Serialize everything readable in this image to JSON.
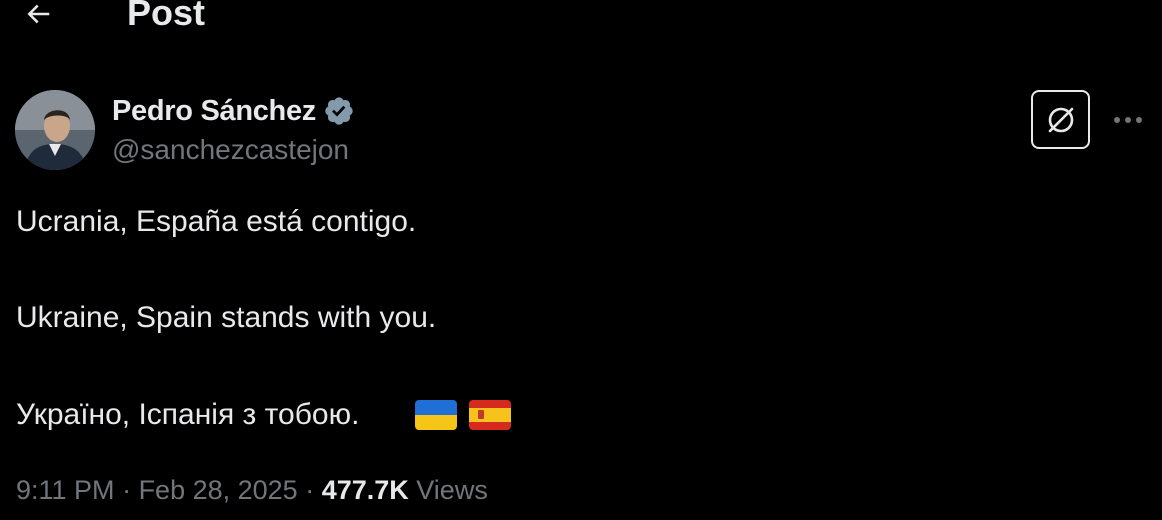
{
  "header": {
    "title": "Post",
    "back_icon": "arrow-left-icon"
  },
  "author": {
    "name": "Pedro Sánchez",
    "handle": "@sanchezcastejon",
    "verified_color": "#829aab"
  },
  "actions": {
    "grok_icon": "grok-icon",
    "more_icon": "more-dots-icon"
  },
  "post": {
    "lines": [
      "Ucrania, España está contigo.",
      "Ukraine, Spain stands with you.",
      "Україно, Іспанія з тобою."
    ],
    "flags": [
      "ukraine-flag",
      "spain-flag"
    ]
  },
  "meta": {
    "time": "9:11 PM",
    "separator": " · ",
    "date": "Feb 28, 2025",
    "views_count": "477.7K",
    "views_label": " Views"
  },
  "colors": {
    "background": "#000000",
    "text_primary": "#e7e9ea",
    "text_secondary": "#71767b"
  }
}
